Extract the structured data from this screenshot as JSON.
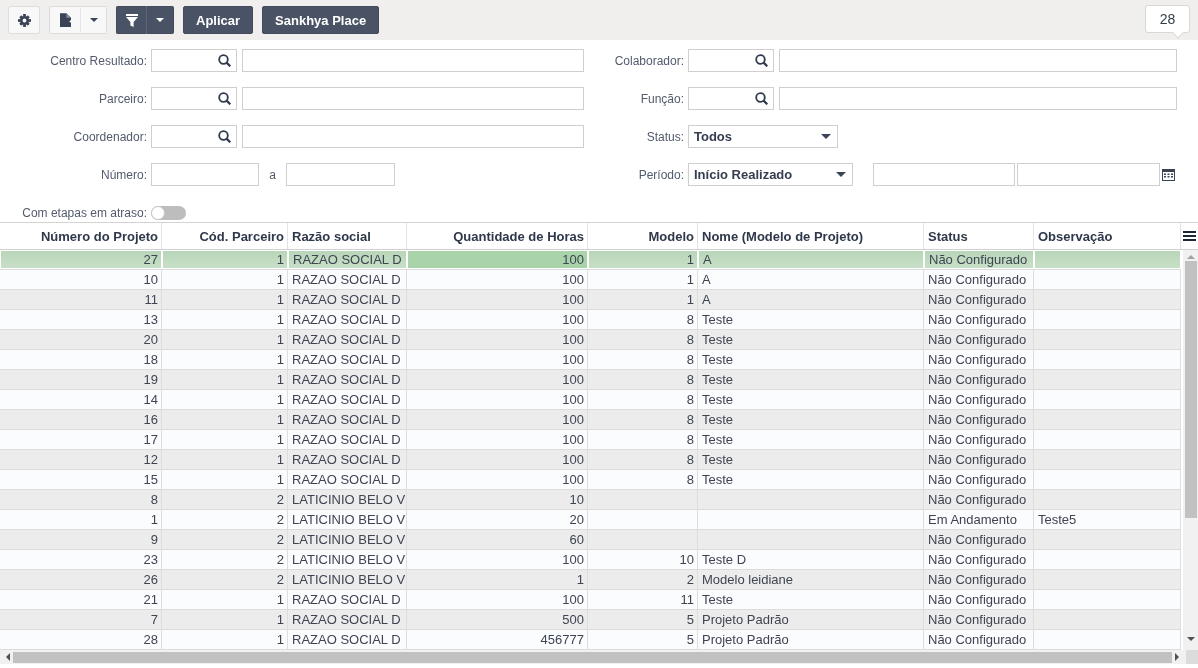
{
  "toolbar": {
    "actions": [
      "Aplicar",
      "Sankhya Place"
    ],
    "record_count": "28"
  },
  "filters": {
    "left": [
      {
        "kind": "lookup",
        "label": "Centro Resultado:"
      },
      {
        "kind": "lookup",
        "label": "Parceiro:"
      },
      {
        "kind": "lookup",
        "label": "Coordenador:"
      },
      {
        "kind": "range",
        "label": "Número:",
        "separator": "a"
      }
    ],
    "right": [
      {
        "kind": "lookup",
        "label": "Colaborador:"
      },
      {
        "kind": "lookup",
        "label": "Função:"
      },
      {
        "kind": "select",
        "label": "Status:",
        "value": "Todos"
      },
      {
        "kind": "select_dates",
        "label": "Período:",
        "value": "Início Realizado"
      }
    ],
    "toggle": {
      "label": "Com etapas em atraso:",
      "on": false
    }
  },
  "table": {
    "columns": [
      {
        "label": "Número do Projeto",
        "kind": "number",
        "focused": false
      },
      {
        "label": "Cód. Parceiro",
        "kind": "number",
        "focused": false
      },
      {
        "label": "Razão social",
        "kind": "text",
        "focused": false
      },
      {
        "label": "Quantidade de Horas",
        "kind": "number",
        "focused": true
      },
      {
        "label": "Modelo",
        "kind": "number",
        "focused": false
      },
      {
        "label": "Nome (Modelo de Projeto)",
        "kind": "text",
        "focused": false
      },
      {
        "label": "Status",
        "kind": "text",
        "focused": false
      },
      {
        "label": "Observação",
        "kind": "text",
        "focused": false
      }
    ],
    "rows": [
      {
        "selected": true,
        "cells": [
          "27",
          "1",
          "RAZAO SOCIAL D",
          "100",
          "1",
          "A",
          "Não Configurado",
          null
        ]
      },
      {
        "selected": false,
        "cells": [
          "10",
          "1",
          "RAZAO SOCIAL D",
          "100",
          "1",
          "A",
          "Não Configurado",
          null
        ]
      },
      {
        "selected": false,
        "cells": [
          "11",
          "1",
          "RAZAO SOCIAL D",
          "100",
          "1",
          "A",
          "Não Configurado",
          null
        ]
      },
      {
        "selected": false,
        "cells": [
          "13",
          "1",
          "RAZAO SOCIAL D",
          "100",
          "8",
          "Teste",
          "Não Configurado",
          null
        ]
      },
      {
        "selected": false,
        "cells": [
          "20",
          "1",
          "RAZAO SOCIAL D",
          "100",
          "8",
          "Teste",
          "Não Configurado",
          null
        ]
      },
      {
        "selected": false,
        "cells": [
          "18",
          "1",
          "RAZAO SOCIAL D",
          "100",
          "8",
          "Teste",
          "Não Configurado",
          null
        ]
      },
      {
        "selected": false,
        "cells": [
          "19",
          "1",
          "RAZAO SOCIAL D",
          "100",
          "8",
          "Teste",
          "Não Configurado",
          null
        ]
      },
      {
        "selected": false,
        "cells": [
          "14",
          "1",
          "RAZAO SOCIAL D",
          "100",
          "8",
          "Teste",
          "Não Configurado",
          null
        ]
      },
      {
        "selected": false,
        "cells": [
          "16",
          "1",
          "RAZAO SOCIAL D",
          "100",
          "8",
          "Teste",
          "Não Configurado",
          null
        ]
      },
      {
        "selected": false,
        "cells": [
          "17",
          "1",
          "RAZAO SOCIAL D",
          "100",
          "8",
          "Teste",
          "Não Configurado",
          null
        ]
      },
      {
        "selected": false,
        "cells": [
          "12",
          "1",
          "RAZAO SOCIAL D",
          "100",
          "8",
          "Teste",
          "Não Configurado",
          null
        ]
      },
      {
        "selected": false,
        "cells": [
          "15",
          "1",
          "RAZAO SOCIAL D",
          "100",
          "8",
          "Teste",
          "Não Configurado",
          null
        ]
      },
      {
        "selected": false,
        "cells": [
          "8",
          "2",
          "LATICINIO BELO V",
          "10",
          null,
          null,
          "Não Configurado",
          null
        ]
      },
      {
        "selected": false,
        "cells": [
          "1",
          "2",
          "LATICINIO BELO V",
          "20",
          null,
          null,
          "Em Andamento",
          "Teste5"
        ]
      },
      {
        "selected": false,
        "cells": [
          "9",
          "2",
          "LATICINIO BELO V",
          "60",
          null,
          null,
          "Não Configurado",
          null
        ]
      },
      {
        "selected": false,
        "cells": [
          "23",
          "2",
          "LATICINIO BELO V",
          "100",
          "10",
          "Teste D",
          "Não Configurado",
          null
        ]
      },
      {
        "selected": false,
        "cells": [
          "26",
          "2",
          "LATICINIO BELO V",
          "1",
          "2",
          "Modelo leidiane",
          "Não Configurado",
          null
        ]
      },
      {
        "selected": false,
        "cells": [
          "21",
          "1",
          "RAZAO SOCIAL D",
          "100",
          "11",
          "Teste",
          "Não Configurado",
          null
        ]
      },
      {
        "selected": false,
        "cells": [
          "7",
          "1",
          "RAZAO SOCIAL D",
          "500",
          "5",
          "Projeto Padrão",
          "Não Configurado",
          null
        ]
      },
      {
        "selected": false,
        "cells": [
          "28",
          "1",
          "RAZAO SOCIAL D",
          "456777",
          "5",
          "Projeto Padrão",
          "Não Configurado",
          null
        ]
      }
    ]
  }
}
